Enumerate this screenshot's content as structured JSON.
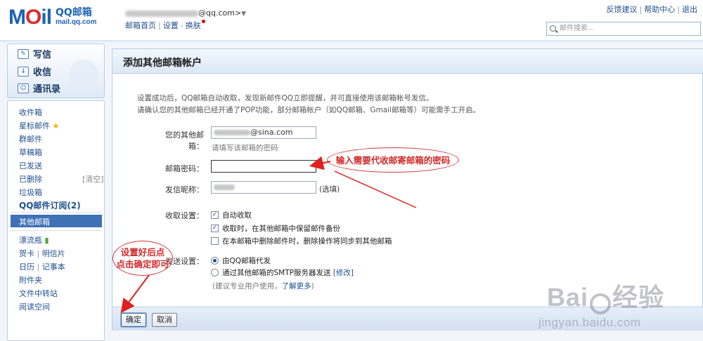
{
  "header": {
    "logo_main": "MOil",
    "logo_product": "QQ邮箱",
    "logo_url": "mail.qq.com",
    "account_suffix": "@qq.com>",
    "caret": "▼",
    "links": [
      "邮箱首页",
      "设置",
      "换肤"
    ],
    "top_links": [
      "反馈建议",
      "帮助中心",
      "退出"
    ],
    "search_placeholder": "邮件搜索..."
  },
  "sidebar": {
    "commands": [
      {
        "label": "写信",
        "icon": "pencil-icon"
      },
      {
        "label": "收信",
        "icon": "inbox-download-icon"
      },
      {
        "label": "通讯录",
        "icon": "contacts-icon"
      }
    ],
    "folders": [
      "收件箱",
      "星标邮件",
      "群邮件",
      "草稿箱",
      "已发送",
      "已删除",
      "垃圾箱"
    ],
    "clean_label": "[清空]",
    "subscriptions": "QQ邮件订阅(2)",
    "active_item": "其他邮箱",
    "tools": {
      "bottle": "漂流瓶",
      "cards": "贺卡",
      "postcards": "明信片",
      "calendar": "日历",
      "notes": "记事本",
      "attachments": "附件夹",
      "transfer": "文件中转站",
      "reading": "阅读空间"
    }
  },
  "main": {
    "title": "添加其他邮箱帐户",
    "intro_line1": "设置成功后，QQ邮箱自动收取，发现新邮件QQ立即提醒，并可直接使用该邮箱帐号发信。",
    "intro_line2": "请确认您的其他邮箱已经开通了POP功能，部分邮箱帐户（如QQ邮箱、Gmail邮箱等）可能需手工开启。",
    "form": {
      "email_label": "您的其他邮箱：",
      "email_suffix": "@sina.com",
      "email_hint": "请填写该邮箱的密码",
      "password_label": "邮箱密码：",
      "nickname_label": "发信昵称：",
      "nickname_optional": "(选填)",
      "receive_label": "收取设置：",
      "receive_options": [
        {
          "label": "自动收取",
          "checked": true
        },
        {
          "label": "收取时，在其他邮箱中保留邮件备份",
          "checked": true
        },
        {
          "label": "在本邮箱中删除邮件时，删除操作将同步到其他邮箱",
          "checked": false
        }
      ],
      "send_label": "发送设置：",
      "send_options": [
        {
          "label": "由QQ邮箱代发",
          "selected": true
        },
        {
          "label": "通过其他邮箱的SMTP服务器发送",
          "selected": false
        }
      ],
      "modify_link": "[修改]",
      "advice_prefix": "(建议专业用户使用，",
      "advice_link": "了解更多",
      "advice_suffix": ")"
    },
    "buttons": {
      "ok": "确定",
      "cancel": "取消"
    }
  },
  "annotations": {
    "password_callout": "输入需要代收邮寄邮箱的密码",
    "confirm_callout_line1": "设置好后点",
    "confirm_callout_line2": "点击确定即可",
    "arrow_color": "#e02020"
  },
  "watermark": {
    "brand_prefix": "Bai",
    "brand_suffix": "经验",
    "url": "jingyan.baidu.com"
  }
}
